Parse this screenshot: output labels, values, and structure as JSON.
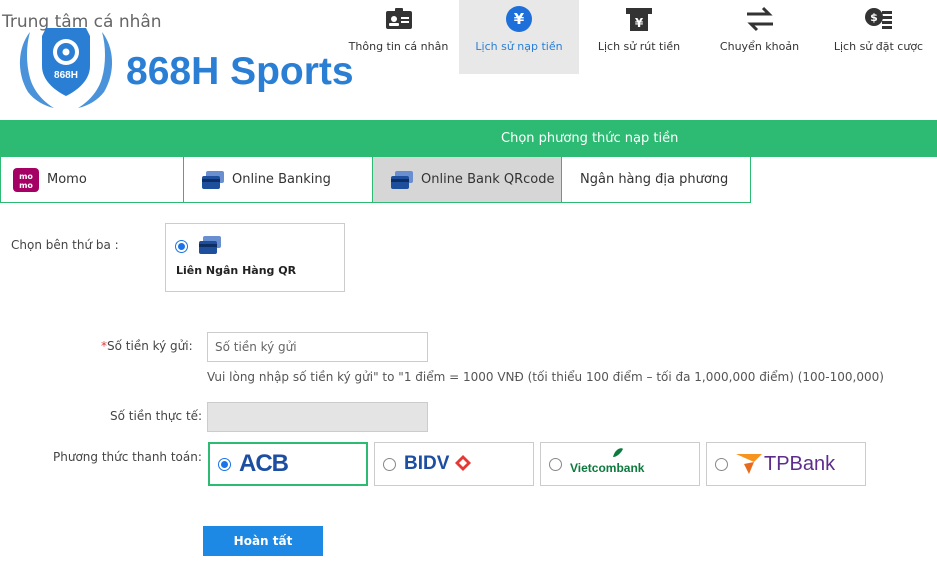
{
  "header": {
    "title": "Trung tâm cá nhân",
    "logo_text": "868H Sports",
    "logo_badge": "868H"
  },
  "nav": [
    {
      "label": "Thông tin cá nhân",
      "icon": "id-card-icon"
    },
    {
      "label": "Lịch sử nạp tiền",
      "icon": "yen-coin-icon",
      "active": true
    },
    {
      "label": "Lịch sử rút tiền",
      "icon": "atm-withdraw-icon"
    },
    {
      "label": "Chuyển khoản",
      "icon": "transfer-arrows-icon"
    },
    {
      "label": "Lịch sử đặt cược",
      "icon": "coin-stack-icon"
    }
  ],
  "section_title": "Chọn phương thức nạp tiền",
  "methods": [
    {
      "label": "Momo",
      "icon": "momo-icon"
    },
    {
      "label": "Online Banking",
      "icon": "card-icon"
    },
    {
      "label": "Online Bank QRcode",
      "icon": "card-icon",
      "active": true
    },
    {
      "label": "Ngân hàng địa phương"
    }
  ],
  "form": {
    "third_party_label": "Chọn bên thứ ba :",
    "third_party_option": "Liên Ngân Hàng QR",
    "amount_required_mark": "*",
    "amount_label": "Số tiền ký gửi:",
    "amount_placeholder": "Số tiền ký gửi",
    "amount_hint": "Vui lòng nhập số tiền ký gửi\" to \"1 điểm = 1000 VNĐ (tối thiểu 100 điểm – tối đa 1,000,000 điểm) (100-100,000)",
    "actual_label": "Số tiền thực tế:",
    "payment_label": "Phương thức thanh toán:",
    "submit_label": "Hoàn tất"
  },
  "banks": [
    {
      "name": "ACB",
      "selected": true,
      "color": "#1c4fa1"
    },
    {
      "name": "BIDV",
      "color": "#1c4fa1"
    },
    {
      "name": "Vietcombank",
      "color": "#0d7a3e"
    },
    {
      "name": "TPBank",
      "color": "#5e2d8c"
    }
  ],
  "colors": {
    "accent_green": "#2dba73",
    "button_blue": "#1e88e5",
    "link_blue": "#2a7fd4"
  }
}
